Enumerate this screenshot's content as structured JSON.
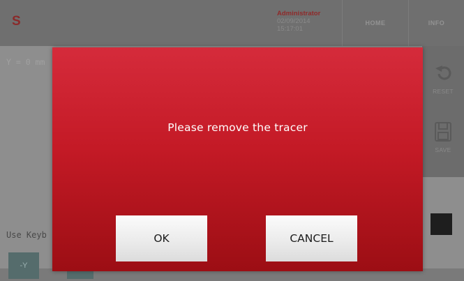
{
  "app": {
    "logo": "S"
  },
  "header": {
    "user": "Administrator",
    "date": "02/09/2014",
    "time": "15:17:01",
    "nav": {
      "home": "HOME",
      "info": "INFO"
    }
  },
  "main": {
    "coord_text": "Y = 0 mm",
    "hint_text": "Use Keyb",
    "key_button": "-Y"
  },
  "sidebar": {
    "reset_label": "RESET",
    "save_label": "SAVE"
  },
  "dialog": {
    "message": "Please remove the tracer",
    "ok_label": "OK",
    "cancel_label": "CANCEL"
  },
  "colors": {
    "dialog_top": "#d52b3b",
    "dialog_bottom": "#9c0e14",
    "button_bg": "#f2f2f2"
  }
}
